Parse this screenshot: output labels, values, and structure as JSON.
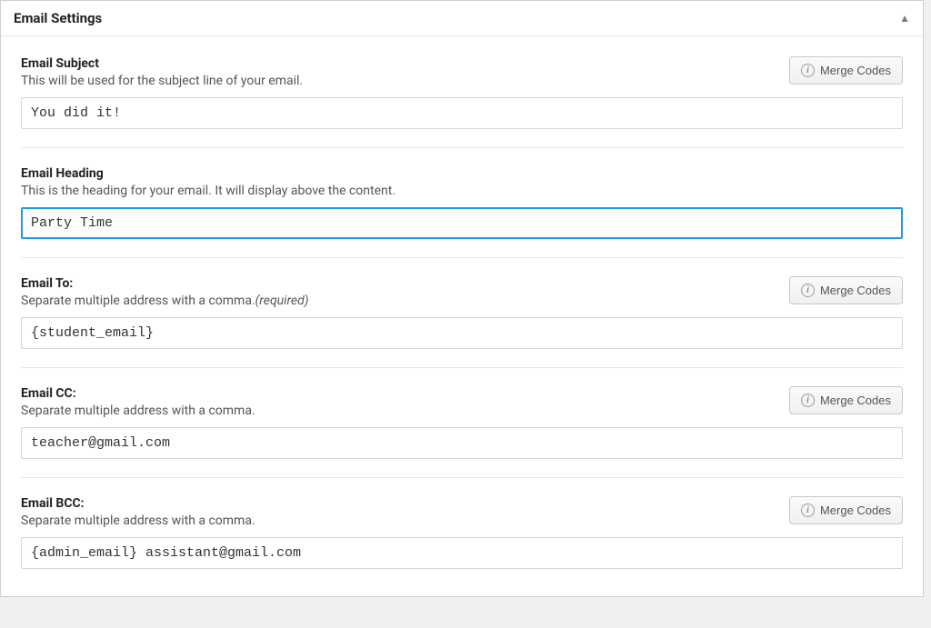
{
  "panel": {
    "title": "Email Settings"
  },
  "merge_button_label": "Merge Codes",
  "fields": {
    "subject": {
      "label": "Email Subject",
      "desc": "This will be used for the subject line of your email.",
      "value": "You did it!",
      "has_merge": true
    },
    "heading": {
      "label": "Email Heading",
      "desc": "This is the heading for your email. It will display above the content.",
      "value": "Party Time",
      "has_merge": false,
      "focused": true
    },
    "to": {
      "label": "Email To:",
      "desc_prefix": "Separate multiple address with a comma.",
      "desc_required": "(required)",
      "value": "{student_email}",
      "has_merge": true
    },
    "cc": {
      "label": "Email CC:",
      "desc": "Separate multiple address with a comma.",
      "value": "teacher@gmail.com",
      "has_merge": true
    },
    "bcc": {
      "label": "Email BCC:",
      "desc": "Separate multiple address with a comma.",
      "value": "{admin_email} assistant@gmail.com",
      "has_merge": true
    }
  }
}
